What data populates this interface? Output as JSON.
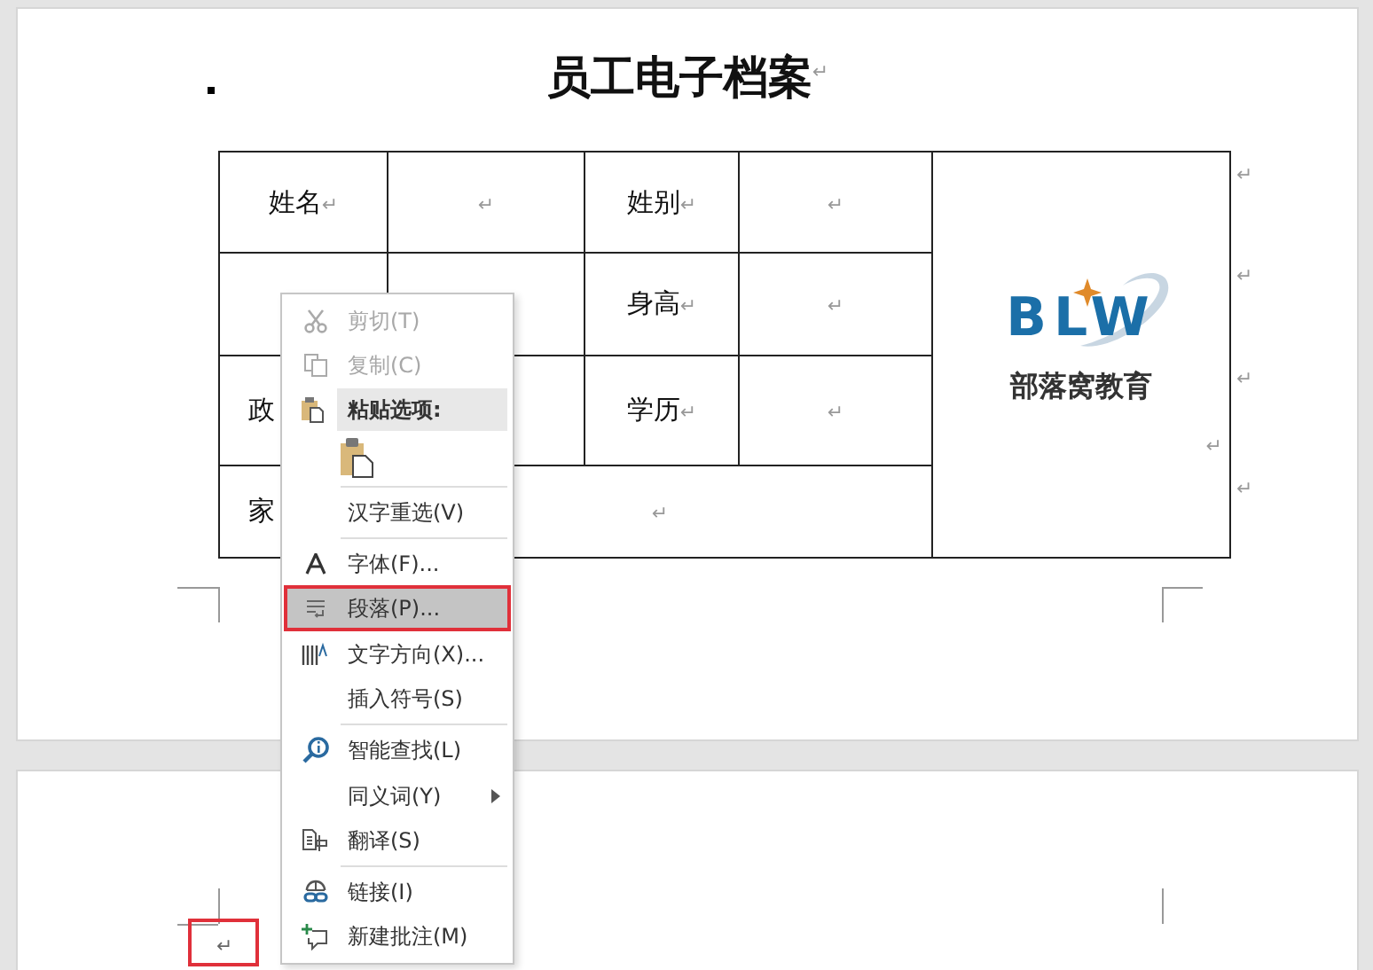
{
  "document": {
    "title": "员工电子档案",
    "title_mark": "↵",
    "rows": [
      {
        "cells": [
          {
            "label": "姓名",
            "mark": "↵"
          },
          {
            "mark": "↵"
          },
          {
            "label": "姓别",
            "mark": "↵"
          },
          {
            "mark": "↵"
          }
        ],
        "end_mark": "↵"
      },
      {
        "cells": [
          {},
          {},
          {
            "label": "身高",
            "mark": "↵"
          },
          {
            "mark": "↵"
          }
        ],
        "end_mark": "↵"
      },
      {
        "cells": [
          {
            "label": "政"
          },
          {},
          {
            "label": "学历",
            "mark": "↵"
          },
          {
            "mark": "↵"
          }
        ],
        "end_mark": "↵"
      },
      {
        "cells": [
          {
            "label": "家"
          },
          {
            "mark": "↵",
            "colspan": 3
          }
        ],
        "end_mark": "↵"
      }
    ],
    "logo": {
      "mark": "BLW",
      "name": "部落窝教育",
      "mark_after": "↵"
    },
    "page2_mark": {
      "text": "↵",
      "outlined": true
    }
  },
  "context_menu": {
    "items": [
      {
        "kind": "item",
        "label": "剪切(T)",
        "disabled": true,
        "highlighted": false
      },
      {
        "kind": "item",
        "label": "复制(C)",
        "disabled": true,
        "highlighted": false
      },
      {
        "kind": "header",
        "label": "粘贴选项:"
      },
      {
        "kind": "paste"
      },
      {
        "kind": "separator"
      },
      {
        "kind": "item",
        "label": "汉字重选(V)",
        "disabled": false,
        "highlighted": false
      },
      {
        "kind": "separator"
      },
      {
        "kind": "item",
        "label": "字体(F)...",
        "disabled": false,
        "highlighted": false
      },
      {
        "kind": "item",
        "label": "段落(P)...",
        "disabled": false,
        "highlighted": true
      },
      {
        "kind": "item",
        "label": "文字方向(X)...",
        "disabled": false,
        "highlighted": false
      },
      {
        "kind": "item",
        "label": "插入符号(S)",
        "disabled": false,
        "highlighted": false
      },
      {
        "kind": "separator"
      },
      {
        "kind": "item",
        "label": "智能查找(L)",
        "disabled": false,
        "highlighted": false
      },
      {
        "kind": "item",
        "label": "同义词(Y)",
        "disabled": false,
        "highlighted": false,
        "submenu": true
      },
      {
        "kind": "item",
        "label": "翻译(S)",
        "disabled": false,
        "highlighted": false
      },
      {
        "kind": "separator"
      },
      {
        "kind": "item",
        "label": "链接(I)",
        "disabled": false,
        "highlighted": false
      },
      {
        "kind": "item",
        "label": "新建批注(M)",
        "disabled": false,
        "highlighted": false
      }
    ]
  }
}
